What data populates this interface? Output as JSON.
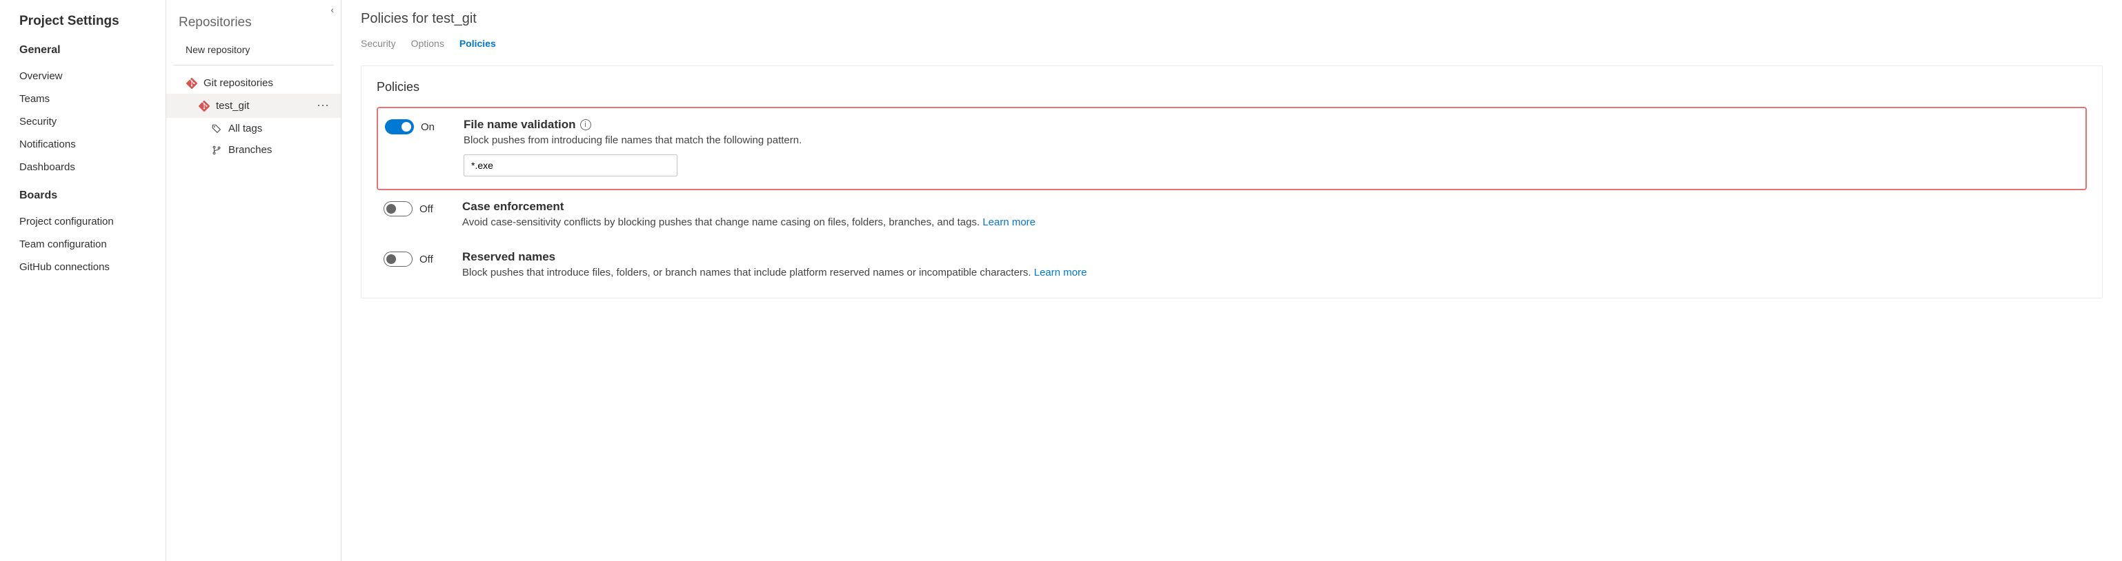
{
  "leftSidebar": {
    "title": "Project Settings",
    "sections": [
      {
        "title": "General",
        "items": [
          "Overview",
          "Teams",
          "Security",
          "Notifications",
          "Dashboards"
        ]
      },
      {
        "title": "Boards",
        "items": [
          "Project configuration",
          "Team configuration",
          "GitHub connections"
        ]
      }
    ]
  },
  "midSidebar": {
    "title": "Repositories",
    "newRepo": "New repository",
    "tree": {
      "root": "Git repositories",
      "repo": "test_git",
      "children": [
        "All tags",
        "Branches"
      ]
    }
  },
  "main": {
    "pageTitle": "Policies for test_git",
    "tabs": [
      "Security",
      "Options",
      "Policies"
    ],
    "activeTab": "Policies",
    "panelHeading": "Policies",
    "toggleLabels": {
      "on": "On",
      "off": "Off"
    },
    "learnMore": "Learn more",
    "policies": [
      {
        "id": "file-name-validation",
        "on": true,
        "highlighted": true,
        "title": "File name validation",
        "hasInfo": true,
        "desc": "Block pushes from introducing file names that match the following pattern.",
        "inputValue": "*.exe",
        "hasLearnMore": false
      },
      {
        "id": "case-enforcement",
        "on": false,
        "highlighted": false,
        "title": "Case enforcement",
        "hasInfo": false,
        "desc": "Avoid case-sensitivity conflicts by blocking pushes that change name casing on files, folders, branches, and tags.",
        "hasLearnMore": true
      },
      {
        "id": "reserved-names",
        "on": false,
        "highlighted": false,
        "title": "Reserved names",
        "hasInfo": false,
        "desc": "Block pushes that introduce files, folders, or branch names that include platform reserved names or incompatible characters.",
        "hasLearnMore": true
      }
    ]
  }
}
